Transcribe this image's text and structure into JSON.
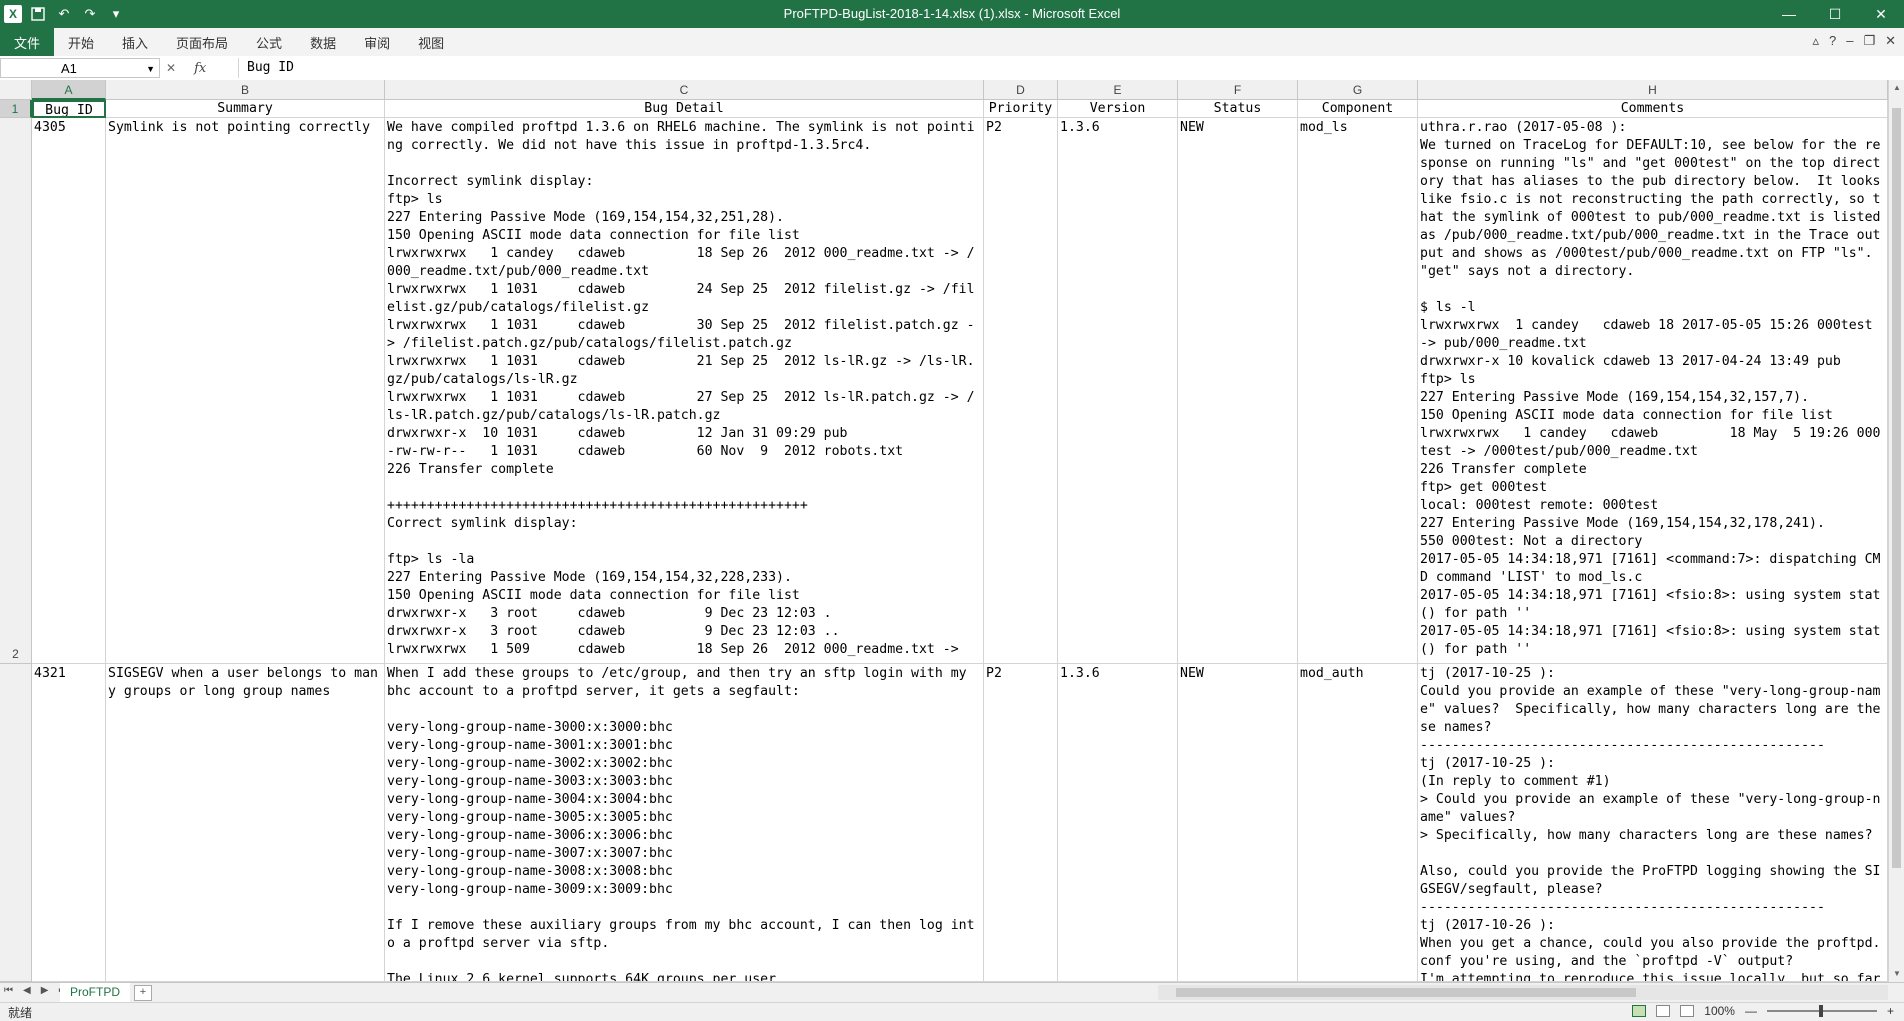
{
  "window": {
    "title": "ProFTPD-BugList-2018-1-14.xlsx (1).xlsx - Microsoft Excel",
    "logo": "X",
    "minimize": "—",
    "restore": "☐",
    "close": "✕"
  },
  "ribbon": {
    "tabs": [
      "文件",
      "开始",
      "插入",
      "页面布局",
      "公式",
      "数据",
      "审阅",
      "视图"
    ]
  },
  "formula_bar": {
    "name_box": "A1",
    "fx": "fx",
    "cancel": "✕",
    "enter": "✓",
    "value": "Bug ID"
  },
  "columns": [
    "A",
    "B",
    "C",
    "D",
    "E",
    "F",
    "G",
    "H"
  ],
  "rows": [
    "1",
    "2"
  ],
  "header_row": [
    "Bug ID",
    "Summary",
    "Bug Detail",
    "Priority",
    "Version",
    "Status",
    "Component",
    "Comments"
  ],
  "records": [
    {
      "bug_id": "4305",
      "summary": "Symlink is not pointing correctly",
      "detail": "We have compiled proftpd 1.3.6 on RHEL6 machine. The symlink is not pointing correctly. We did not have this issue in proftpd-1.3.5rc4.\n\nIncorrect symlink display:\nftp> ls\n227 Entering Passive Mode (169,154,154,32,251,28).\n150 Opening ASCII mode data connection for file list\nlrwxrwxrwx   1 candey   cdaweb         18 Sep 26  2012 000_readme.txt -> /000_readme.txt/pub/000_readme.txt\nlrwxrwxrwx   1 1031     cdaweb         24 Sep 25  2012 filelist.gz -> /filelist.gz/pub/catalogs/filelist.gz\nlrwxrwxrwx   1 1031     cdaweb         30 Sep 25  2012 filelist.patch.gz -> /filelist.patch.gz/pub/catalogs/filelist.patch.gz\nlrwxrwxrwx   1 1031     cdaweb         21 Sep 25  2012 ls-lR.gz -> /ls-lR.gz/pub/catalogs/ls-lR.gz\nlrwxrwxrwx   1 1031     cdaweb         27 Sep 25  2012 ls-lR.patch.gz -> /ls-lR.patch.gz/pub/catalogs/ls-lR.patch.gz\ndrwxrwxr-x  10 1031     cdaweb         12 Jan 31 09:29 pub\n-rw-rw-r--   1 1031     cdaweb         60 Nov  9  2012 robots.txt\n226 Transfer complete\n\n+++++++++++++++++++++++++++++++++++++++++++++++++++++\nCorrect symlink display:\n\nftp> ls -la\n227 Entering Passive Mode (169,154,154,32,228,233).\n150 Opening ASCII mode data connection for file list\ndrwxrwxr-x   3 root     cdaweb          9 Dec 23 12:03 .\ndrwxrwxr-x   3 root     cdaweb          9 Dec 23 12:03 ..\nlrwxrwxrwx   1 509      cdaweb         18 Sep 26  2012 000_readme.txt ->",
      "priority": "P2",
      "version": "1.3.6",
      "status": "NEW",
      "component": "mod_ls",
      "comments": "uthra.r.rao (2017-05-08 ):\nWe turned on TraceLog for DEFAULT:10, see below for the response on running \"ls\" and \"get 000test\" on the top directory that has aliases to the pub directory below.  It looks like fsio.c is not reconstructing the path correctly, so that the symlink of 000test to pub/000_readme.txt is listed as /pub/000_readme.txt/pub/000_readme.txt in the Trace output and shows as /000test/pub/000_readme.txt on FTP \"ls\". \"get\" says not a directory.\n\n$ ls -l\nlrwxrwxrwx  1 candey   cdaweb 18 2017-05-05 15:26 000test -> pub/000_readme.txt\ndrwxrwxr-x 10 kovalick cdaweb 13 2017-04-24 13:49 pub\nftp> ls\n227 Entering Passive Mode (169,154,154,32,157,7).\n150 Opening ASCII mode data connection for file list\nlrwxrwxrwx   1 candey   cdaweb         18 May  5 19:26 000test -> /000test/pub/000_readme.txt\n226 Transfer complete\nftp> get 000test\nlocal: 000test remote: 000test\n227 Entering Passive Mode (169,154,154,32,178,241).\n550 000test: Not a directory\n2017-05-05 14:34:18,971 [7161] <command:7>: dispatching CMD command 'LIST' to mod_ls.c\n2017-05-05 14:34:18,971 [7161] <fsio:8>: using system stat() for path ''\n2017-05-05 14:34:18,971 [7161] <fsio:8>: using system stat() for path ''"
    },
    {
      "bug_id": "4321",
      "summary": "SIGSEGV when a user belongs to many groups or long group names",
      "detail": "When I add these groups to /etc/group, and then try an sftp login with my bhc account to a proftpd server, it gets a segfault:\n\nvery-long-group-name-3000:x:3000:bhc\nvery-long-group-name-3001:x:3001:bhc\nvery-long-group-name-3002:x:3002:bhc\nvery-long-group-name-3003:x:3003:bhc\nvery-long-group-name-3004:x:3004:bhc\nvery-long-group-name-3005:x:3005:bhc\nvery-long-group-name-3006:x:3006:bhc\nvery-long-group-name-3007:x:3007:bhc\nvery-long-group-name-3008:x:3008:bhc\nvery-long-group-name-3009:x:3009:bhc\n\nIf I remove these auxiliary groups from my bhc account, I can then log into a proftpd server via sftp.\n\nThe Linux 2.6 kernel supports 64K groups per user.",
      "priority": "P2",
      "version": "1.3.6",
      "status": "NEW",
      "component": "mod_auth",
      "comments": "tj (2017-10-25 ):\nCould you provide an example of these \"very-long-group-name\" values?  Specifically, how many characters long are these names?\n---------------------------------------------------\ntj (2017-10-25 ):\n(In reply to comment #1)\n> Could you provide an example of these \"very-long-group-name\" values?\n> Specifically, how many characters long are these names?\n\nAlso, could you provide the ProFTPD logging showing the SIGSEGV/segfault, please?\n---------------------------------------------------\ntj (2017-10-26 ):\nWhen you get a chance, could you also provide the proftpd.conf you're using, and the `proftpd -V` output?\nI'm attempting to reproduce this issue locally, but so far"
    }
  ],
  "sheet_tabs": [
    "ProFTPD"
  ],
  "status_bar": {
    "ready": "就绪",
    "zoom": "100%",
    "minus": "—",
    "plus": "+"
  },
  "icons": {
    "save": "save-icon",
    "undo": "undo-icon",
    "redo": "redo-icon",
    "help": "help-icon"
  },
  "colors": {
    "accent": "#217346",
    "grid_line": "#d4d4d4",
    "header_bg": "#f0f0f0"
  }
}
